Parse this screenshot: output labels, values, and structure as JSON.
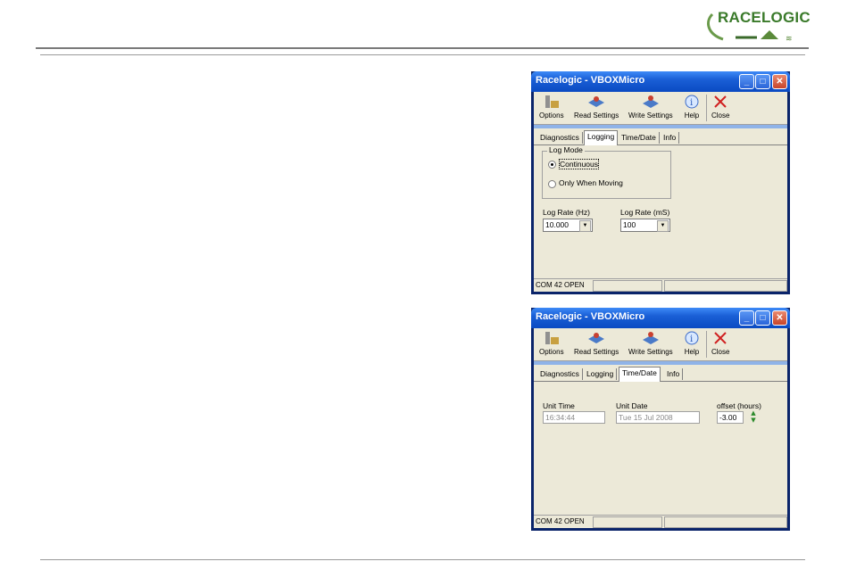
{
  "brand": {
    "logo_text": "RACELOGIC",
    "accent": "#3a7a2a"
  },
  "windows": [
    {
      "title": "Racelogic - VBOXMicro",
      "toolbar": [
        {
          "label": "Options",
          "icon": "options-icon"
        },
        {
          "label": "Read Settings",
          "icon": "read-settings-icon"
        },
        {
          "label": "Write Settings",
          "icon": "write-settings-icon"
        },
        {
          "label": "Help",
          "icon": "help-icon"
        },
        {
          "label": "Close",
          "icon": "close-icon"
        }
      ],
      "tabs": [
        "Diagnostics",
        "Logging",
        "Time/Date",
        "Info"
      ],
      "active_tab": "Logging",
      "logging": {
        "group_label": "Log Mode",
        "option_continuous": "Continuous",
        "option_moving": "Only When Moving",
        "selected": "Continuous",
        "rate_hz_label": "Log Rate (Hz)",
        "rate_hz_value": "10.000",
        "rate_ms_label": "Log Rate (mS)",
        "rate_ms_value": "100"
      },
      "status": "COM 42 OPEN"
    },
    {
      "title": "Racelogic - VBOXMicro",
      "toolbar": [
        {
          "label": "Options",
          "icon": "options-icon"
        },
        {
          "label": "Read Settings",
          "icon": "read-settings-icon"
        },
        {
          "label": "Write Settings",
          "icon": "write-settings-icon"
        },
        {
          "label": "Help",
          "icon": "help-icon"
        },
        {
          "label": "Close",
          "icon": "close-icon"
        }
      ],
      "tabs": [
        "Diagnostics",
        "Logging",
        "Time/Date",
        "Info"
      ],
      "active_tab": "Time/Date",
      "timedate": {
        "unit_time_label": "Unit Time",
        "unit_time_value": "16:34:44",
        "unit_date_label": "Unit Date",
        "unit_date_value": "Tue 15 Jul 2008",
        "offset_label": "offset (hours)",
        "offset_value": "-3.00"
      },
      "status": "COM 42 OPEN"
    }
  ]
}
